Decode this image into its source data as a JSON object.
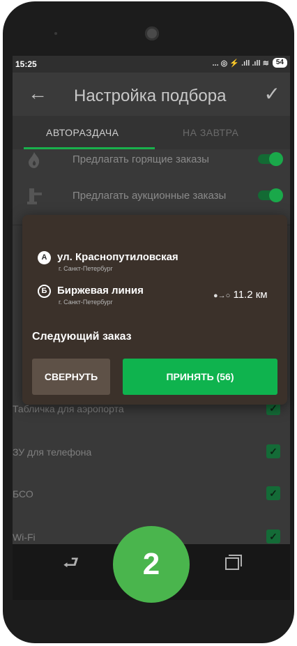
{
  "status_bar": {
    "time": "15:25",
    "icons": "... ◎ ⚡ .ıll .ıll ≋",
    "battery": "54"
  },
  "app_bar": {
    "back_icon": "arrow-left-icon",
    "title": "Настройка подбора",
    "confirm_icon": "checkmark-icon"
  },
  "tabs": [
    {
      "label": "АВТОРАЗДАЧА",
      "active": true
    },
    {
      "label": "НА ЗАВТРА",
      "active": false
    }
  ],
  "settings": [
    {
      "label": "Предлагать горящие заказы",
      "icon": "fire-icon",
      "enabled": true
    },
    {
      "label": "Предлагать аукционные заказы",
      "icon": "gavel-icon",
      "enabled": true
    }
  ],
  "options": [
    {
      "label": "Табличка для аэропорта",
      "checked": true
    },
    {
      "label": "ЗУ для телефона",
      "checked": true
    },
    {
      "label": "БСО",
      "checked": true
    },
    {
      "label": "Wi-Fi",
      "checked": true
    }
  ],
  "order_dialog": {
    "pickup": {
      "marker": "А",
      "address": "ул. Краснопутиловская",
      "city": "г. Санкт-Петербург"
    },
    "dropoff": {
      "marker": "Б",
      "address": "Биржевая линия",
      "city": "г. Санкт-Петербург"
    },
    "distance": "11.2 км",
    "heading": "Следующий заказ",
    "collapse_label": "СВЕРНУТЬ",
    "accept_label": "ПРИНЯТЬ (56)"
  },
  "step_badge": "2",
  "colors": {
    "accent": "#0fb34e",
    "badge": "#4ab54d",
    "dialog": "#3b312a"
  }
}
